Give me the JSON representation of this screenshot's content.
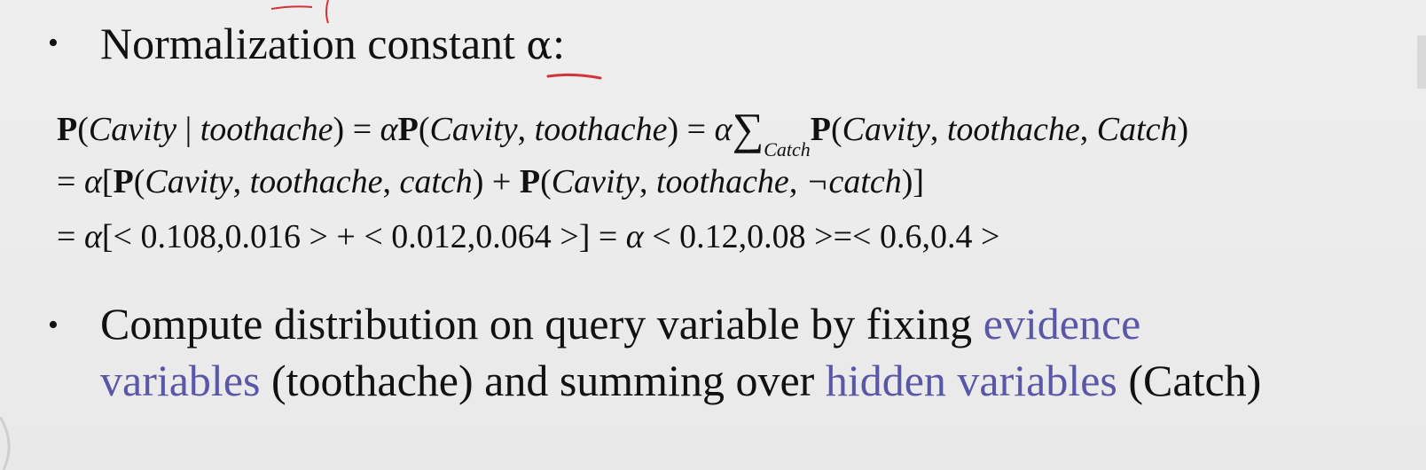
{
  "bullet1": {
    "marker": "•",
    "text": "Normalization constant ",
    "symbol": "α",
    "colon": ":"
  },
  "equations": {
    "line1": {
      "p1": "P",
      "a": "(",
      "cavity": "Cavity",
      "bar": " | ",
      "toothache": "toothache",
      "b": ") = ",
      "alpha": "α",
      "p2": "P",
      "c": "(",
      "cavity2": "Cavity",
      "comma1": ", ",
      "toothache2": "toothache",
      "d": ") = ",
      "alpha2": "α",
      "sigma": "∑",
      "sub": "Catch",
      "p3": "P",
      "e": "(",
      "cavity3": "Cavity",
      "comma2": ", ",
      "toothache3": "toothache",
      "comma3": ", ",
      "catch": "Catch",
      "f": ")"
    },
    "line2": {
      "eq": "= ",
      "alpha": "α",
      "lb": "[",
      "p1": "P",
      "a": "(",
      "cavity": "Cavity",
      "c1": ", ",
      "toothache": "toothache",
      "c2": ", ",
      "catch": "catch",
      "plus": ") + ",
      "p2": "P",
      "b": "(",
      "cavity2": "Cavity",
      "c3": ", ",
      "toothache2": "toothache",
      "c4": ", ",
      "notcatch": "¬catch",
      "end": ")]"
    },
    "line3": {
      "eq": "= ",
      "alpha": "α",
      "rest": "[< 0.108,0.016 > + < 0.012,0.064 >] = ",
      "alpha2": "α",
      "rest2": " < 0.12,0.08 >=< 0.6,0.4 >"
    }
  },
  "bullet2": {
    "marker": "•",
    "line1_plain": "Compute distribution on query variable by fixing ",
    "line1_accent": "evidence",
    "line2_accent1": "variables",
    "line2_plain1": " (toothache) and summing over ",
    "line2_accent2": "hidden variables",
    "line2_plain2": " (Catch)"
  },
  "colors": {
    "background": "#ececec",
    "text": "#111111",
    "accent": "#5a57a8",
    "annotation": "#d2323a"
  }
}
